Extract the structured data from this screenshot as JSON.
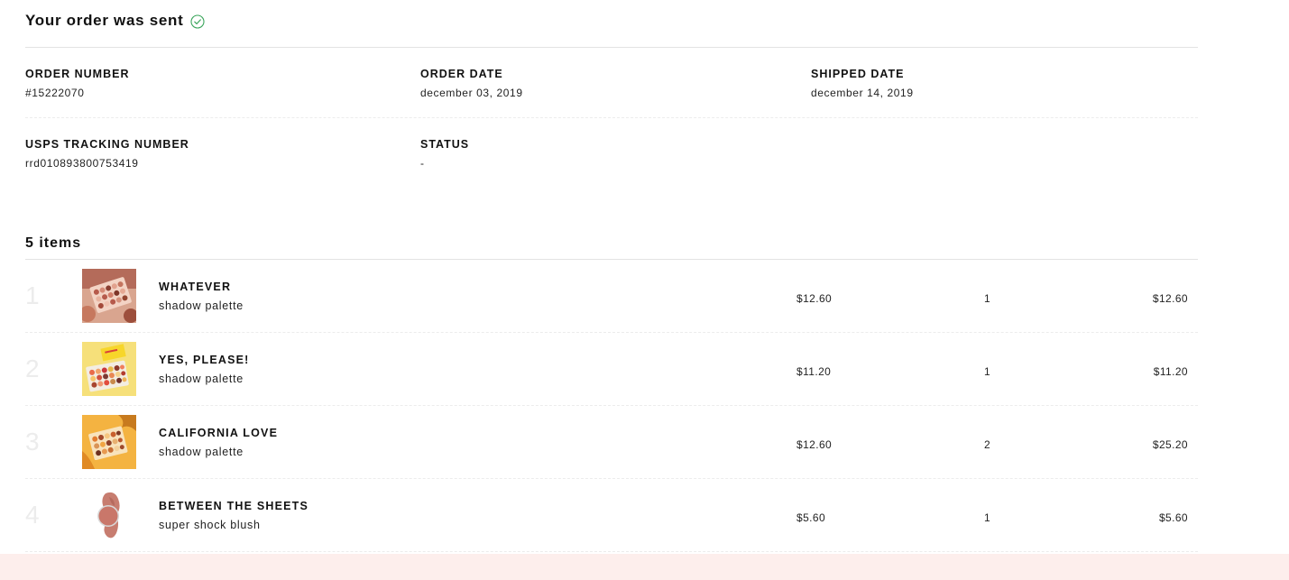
{
  "order": {
    "title": "Your order was sent",
    "status_icon": "check-circle-icon",
    "accent_color": "#3aa55b",
    "fields": {
      "order_number": {
        "label": "ORDER NUMBER",
        "value": "#15222070"
      },
      "order_date": {
        "label": "ORDER DATE",
        "value": "december 03, 2019"
      },
      "shipped_date": {
        "label": "SHIPPED DATE",
        "value": "december 14, 2019"
      },
      "tracking_number": {
        "label": "USPS TRACKING NUMBER",
        "value": "rrd010893800753419"
      },
      "status": {
        "label": "STATUS",
        "value": "-"
      }
    }
  },
  "items": {
    "count_label": "5 items",
    "list": [
      {
        "index": "1",
        "name": "WHATEVER",
        "sub": "shadow palette",
        "price": "$12.60",
        "qty": "1",
        "total": "$12.60",
        "thumb": "palette-whatever"
      },
      {
        "index": "2",
        "name": "YES, PLEASE!",
        "sub": "shadow palette",
        "price": "$11.20",
        "qty": "1",
        "total": "$11.20",
        "thumb": "palette-yes-please"
      },
      {
        "index": "3",
        "name": "CALIFORNIA LOVE",
        "sub": "shadow palette",
        "price": "$12.60",
        "qty": "2",
        "total": "$25.20",
        "thumb": "palette-california-love"
      },
      {
        "index": "4",
        "name": "BETWEEN THE SHEETS",
        "sub": "super shock blush",
        "price": "$5.60",
        "qty": "1",
        "total": "$5.60",
        "thumb": "blush-between-the-sheets"
      }
    ]
  },
  "theme": {
    "footer_band": "#fdeeec",
    "index_color": "#ececec"
  }
}
